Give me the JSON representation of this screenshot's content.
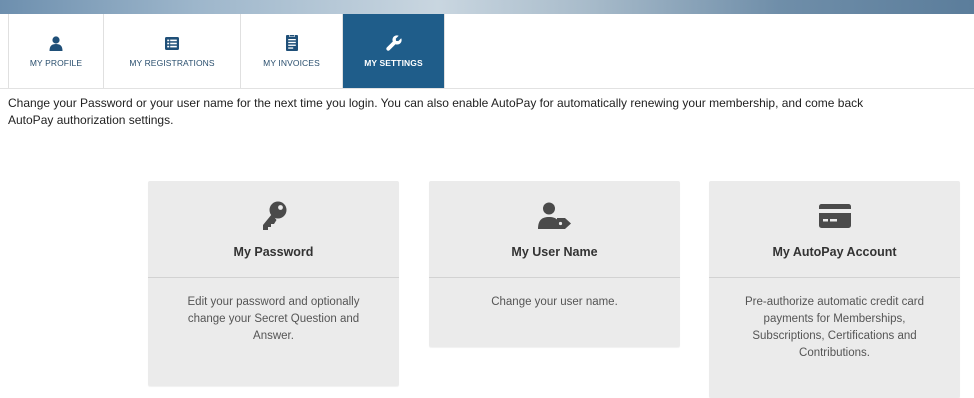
{
  "tabs": [
    {
      "label": "MY PROFILE",
      "icon": "user-icon",
      "active": false
    },
    {
      "label": "MY REGISTRATIONS",
      "icon": "list-icon",
      "active": false
    },
    {
      "label": "MY INVOICES",
      "icon": "invoice-icon",
      "active": false
    },
    {
      "label": "MY SETTINGS",
      "icon": "wrench-icon",
      "active": true
    }
  ],
  "intro": {
    "line1": "Change your Password or your user name for the next time you login. You can also enable AutoPay for automatically renewing your membership, and come back",
    "line2": "AutoPay authorization settings."
  },
  "cards": [
    {
      "title": "My Password",
      "icon": "key-icon",
      "description": "Edit your password and optionally change your Secret Question and Answer."
    },
    {
      "title": "My User Name",
      "icon": "user-tag-icon",
      "description": "Change your user name."
    },
    {
      "title": "My AutoPay Account",
      "icon": "credit-card-icon",
      "description": "Pre-authorize automatic credit card payments for Memberships, Subscriptions, Certifications and Contributions."
    }
  ],
  "colors": {
    "active_tab": "#1f5d8a",
    "tab_icon": "#1f4f78",
    "card_bg": "#ebebeb",
    "card_icon": "#4a4a4a"
  }
}
